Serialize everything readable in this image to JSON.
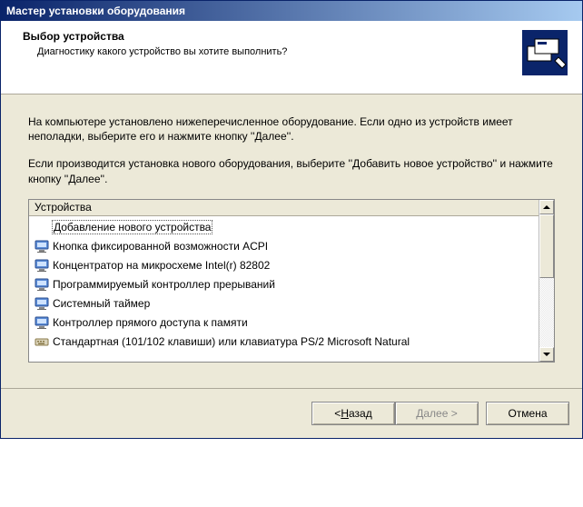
{
  "window": {
    "title": "Мастер установки оборудования"
  },
  "header": {
    "title": "Выбор устройства",
    "subtitle": "Диагностику какого устройство вы хотите выполнить?"
  },
  "content": {
    "para1": "На компьютере установлено нижеперечисленное оборудование. Если одно из устройств имеет неполадки, выберите его и нажмите кнопку ''Далее''.",
    "para2": "Если производится установка нового оборудования, выберите ''Добавить новое устройство'' и нажмите кнопку ''Далее''."
  },
  "list": {
    "header": "Устройства",
    "items": [
      {
        "icon": "none",
        "label": "Добавление нового устройства",
        "selected": true
      },
      {
        "icon": "monitor",
        "label": "Кнопка фиксированной возможности ACPI"
      },
      {
        "icon": "monitor",
        "label": "Концентратор на микросхеме Intel(r) 82802"
      },
      {
        "icon": "monitor",
        "label": "Программируемый контроллер прерываний"
      },
      {
        "icon": "monitor",
        "label": "Системный таймер"
      },
      {
        "icon": "monitor",
        "label": "Контроллер прямого доступа к памяти"
      },
      {
        "icon": "keyboard",
        "label": "Стандартная (101/102 клавиши) или клавиатура PS/2 Microsoft Natural"
      }
    ]
  },
  "buttons": {
    "back_prefix": "< ",
    "back_u": "Н",
    "back_rest": "азад",
    "next_u": "Д",
    "next_rest": "алее >",
    "cancel": "Отмена"
  }
}
